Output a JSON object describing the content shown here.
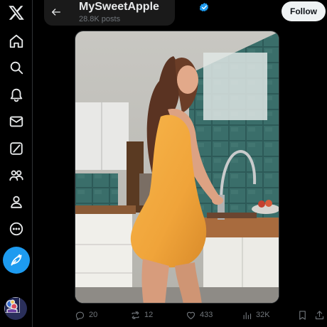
{
  "header": {
    "profile_name": "MySweetApple",
    "post_count": "28.8K posts",
    "follow_label": "Follow"
  },
  "nav": {
    "icons": [
      "x-logo-icon",
      "home-icon",
      "search-icon",
      "notifications-bell-icon",
      "messages-envelope-icon",
      "grok-icon",
      "communities-icon",
      "profile-icon",
      "more-icon"
    ],
    "compose_icon": "compose-post-icon"
  },
  "media": {
    "alt": "Photo of a woman in an orange dress in a kitchen"
  },
  "actions": {
    "replies": "20",
    "reposts": "12",
    "likes": "433",
    "views": "32K"
  },
  "colors": {
    "background": "#000000",
    "accent": "#1d9bf0",
    "text": "#e7e9ea",
    "muted": "#71767b",
    "follow_bg": "#eff3f4"
  }
}
